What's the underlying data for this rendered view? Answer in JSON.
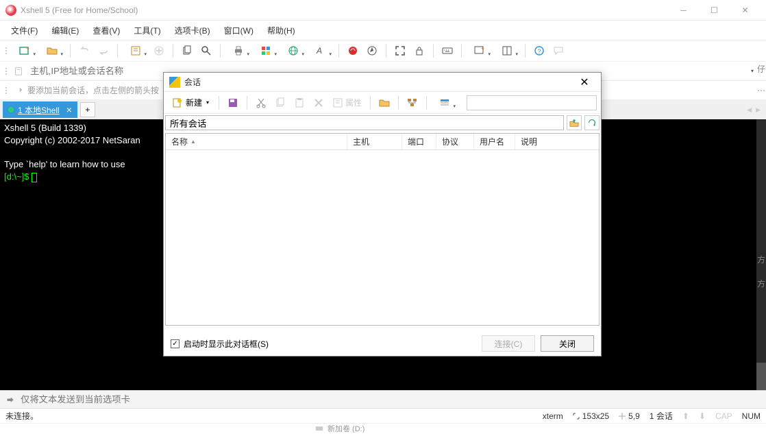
{
  "titlebar": {
    "title": "Xshell 5 (Free for Home/School)"
  },
  "menu": {
    "file": "文件(F)",
    "edit": "编辑(E)",
    "view": "查看(V)",
    "tools": "工具(T)",
    "tabs": "选项卡(B)",
    "window": "窗口(W)",
    "help": "帮助(H)"
  },
  "address": {
    "placeholder": "主机,IP地址或会话名称"
  },
  "tip": {
    "text": "要添加当前会话，点击左侧的箭头按"
  },
  "tab": {
    "label": "1 本地Shell"
  },
  "terminal": {
    "line1": "Xshell 5 (Build 1339)",
    "line2": "Copyright (c) 2002-2017 NetSaran",
    "line3": "Type `help' to learn how to use ",
    "prompt": "[d:\\~]$ "
  },
  "send": {
    "placeholder": "仅将文本发送到当前选项卡"
  },
  "status": {
    "conn": "未连接。",
    "term": "xterm",
    "size": "153x25",
    "pos": "5,9",
    "sess": "1 会话",
    "cap": "CAP",
    "num": "NUM"
  },
  "bottom": {
    "partial": "新加卷 (D:)"
  },
  "dialog": {
    "title": "会话",
    "new_label": "新建",
    "prop_label": "属性",
    "path": "所有会话",
    "cols": {
      "name": "名称",
      "host": "主机",
      "port": "端口",
      "proto": "协议",
      "user": "用户名",
      "desc": "说明"
    },
    "checkbox": "启动时显示此对话框(S)",
    "connect": "连接(C)",
    "close": "关闭"
  }
}
